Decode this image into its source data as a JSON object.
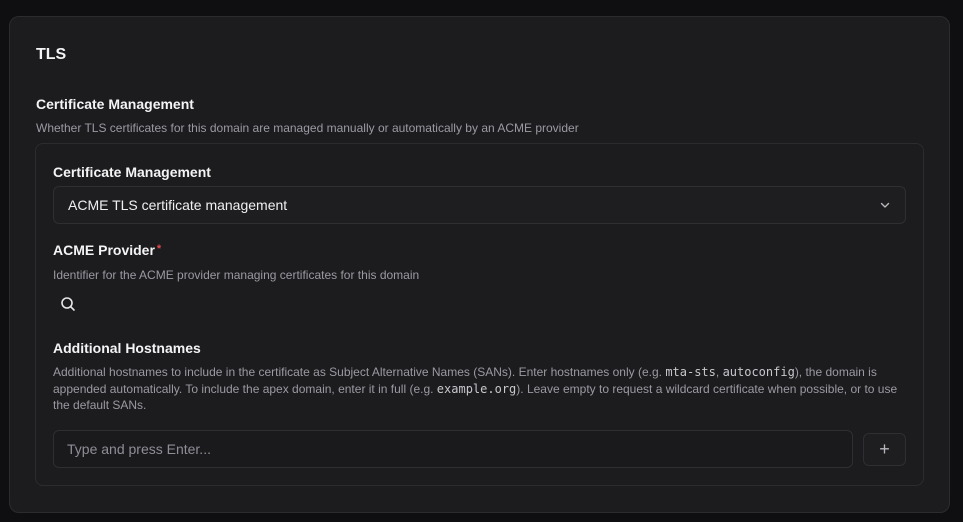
{
  "card": {
    "title": "TLS"
  },
  "section": {
    "title": "Certificate Management",
    "description": "Whether TLS certificates for this domain are managed manually or automatically by an ACME provider"
  },
  "certificate_management": {
    "label": "Certificate Management",
    "selected": "ACME TLS certificate management"
  },
  "acme_provider": {
    "label": "ACME Provider",
    "required_marker": "*",
    "description": "Identifier for the ACME provider managing certificates for this domain"
  },
  "additional_hostnames": {
    "label": "Additional Hostnames",
    "description_parts": {
      "p1": "Additional hostnames to include in the certificate as Subject Alternative Names (SANs). Enter hostnames only (e.g. ",
      "code1": "mta-sts",
      "p2": ", ",
      "code2": "autoconfig",
      "p3": "), the domain is appended automatically. To include the apex domain, enter it in full (e.g. ",
      "code3": "example.org",
      "p4": "). Leave empty to request a wildcard certificate when possible, or to use the default SANs."
    },
    "placeholder": "Type and press Enter...",
    "add_symbol": "+"
  },
  "icons": {
    "search": "search-icon",
    "chevron": "chevron-down-icon",
    "add": "plus-icon"
  },
  "colors": {
    "background": "#0f0f11",
    "card": "#1c1c1f",
    "border": "#2c2c30",
    "required": "#e5484d",
    "muted_text": "#9a9aa2"
  }
}
